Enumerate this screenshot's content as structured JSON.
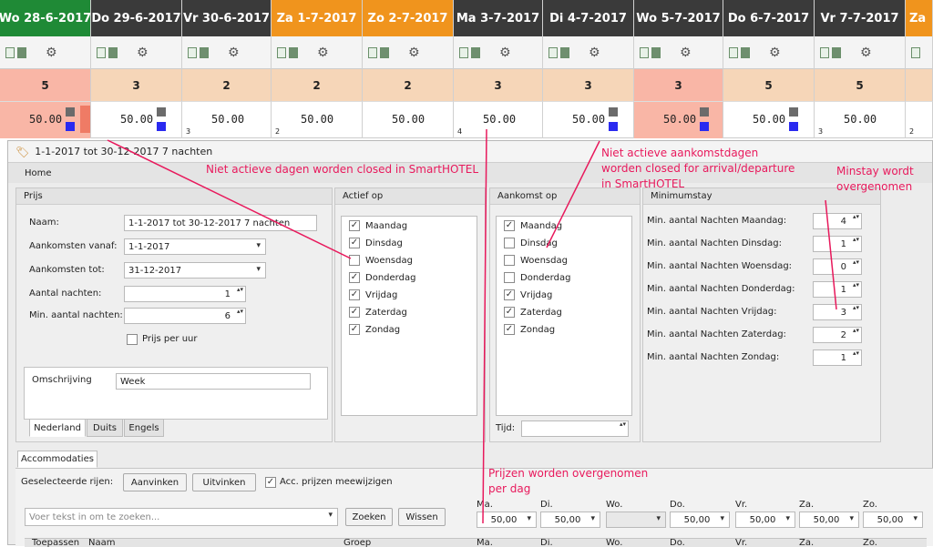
{
  "calendar": {
    "days": [
      {
        "label": "Wo 28-6-2017",
        "color": "#1f8a36",
        "count": "5",
        "price": "50.00",
        "num": ""
      },
      {
        "label": "Do 29-6-2017",
        "color": "#3a3a3a",
        "count": "3",
        "price": "50.00",
        "num": ""
      },
      {
        "label": "Vr 30-6-2017",
        "color": "#3a3a3a",
        "count": "2",
        "price": "50.00",
        "num": "3"
      },
      {
        "label": "Za 1-7-2017",
        "color": "#f0941d",
        "count": "2",
        "price": "50.00",
        "num": "2"
      },
      {
        "label": "Zo 2-7-2017",
        "color": "#f0941d",
        "count": "2",
        "price": "50.00",
        "num": ""
      },
      {
        "label": "Ma 3-7-2017",
        "color": "#3a3a3a",
        "count": "3",
        "price": "50.00",
        "num": "4"
      },
      {
        "label": "Di 4-7-2017",
        "color": "#3a3a3a",
        "count": "3",
        "price": "50.00",
        "num": ""
      },
      {
        "label": "Wo 5-7-2017",
        "color": "#3a3a3a",
        "count": "3",
        "price": "50.00",
        "num": ""
      },
      {
        "label": "Do 6-7-2017",
        "color": "#3a3a3a",
        "count": "5",
        "price": "50.00",
        "num": ""
      },
      {
        "label": "Vr 7-7-2017",
        "color": "#3a3a3a",
        "count": "5",
        "price": "50.00",
        "num": "3"
      },
      {
        "label": "Za",
        "color": "#f0941d",
        "count": "",
        "price": "",
        "num": "2"
      }
    ]
  },
  "dialog": {
    "title": "1-1-2017 tot 30-12-2017 7 nachten",
    "home_tab": "Home",
    "prijs": {
      "title": "Prijs",
      "naam_label": "Naam:",
      "naam_value": "1-1-2017 tot 30-12-2017 7 nachten",
      "aankomsten_vanaf_label": "Aankomsten vanaf:",
      "aankomsten_vanaf_value": "1-1-2017",
      "aankomsten_tot_label": "Aankomsten tot:",
      "aankomsten_tot_value": "31-12-2017",
      "aantal_nachten_label": "Aantal nachten:",
      "aantal_nachten_value": "1",
      "min_aantal_nachten_label": "Min. aantal nachten:",
      "min_aantal_nachten_value": "6",
      "prijs_per_uur_label": "Prijs per uur",
      "omschrijving_label": "Omschrijving",
      "omschrijving_value": "Week",
      "tabs": [
        "Nederland",
        "Duits",
        "Engels"
      ]
    },
    "actief_op": {
      "title": "Actief op",
      "days": [
        {
          "label": "Maandag",
          "checked": true
        },
        {
          "label": "Dinsdag",
          "checked": true
        },
        {
          "label": "Woensdag",
          "checked": false
        },
        {
          "label": "Donderdag",
          "checked": true
        },
        {
          "label": "Vrijdag",
          "checked": true
        },
        {
          "label": "Zaterdag",
          "checked": true
        },
        {
          "label": "Zondag",
          "checked": true
        }
      ]
    },
    "aankomst_op": {
      "title": "Aankomst op",
      "days": [
        {
          "label": "Maandag",
          "checked": true
        },
        {
          "label": "Dinsdag",
          "checked": false
        },
        {
          "label": "Woensdag",
          "checked": false
        },
        {
          "label": "Donderdag",
          "checked": false
        },
        {
          "label": "Vrijdag",
          "checked": true
        },
        {
          "label": "Zaterdag",
          "checked": true
        },
        {
          "label": "Zondag",
          "checked": true
        }
      ],
      "tijd_label": "Tijd:"
    },
    "minimumstay": {
      "title": "Minimumstay",
      "rows": [
        {
          "label": "Min. aantal Nachten Maandag:",
          "value": "4"
        },
        {
          "label": "Min. aantal Nachten Dinsdag:",
          "value": "1"
        },
        {
          "label": "Min. aantal Nachten Woensdag:",
          "value": "0"
        },
        {
          "label": "Min. aantal Nachten Donderdag:",
          "value": "1"
        },
        {
          "label": "Min. aantal Nachten Vrijdag:",
          "value": "3"
        },
        {
          "label": "Min. aantal Nachten Zaterdag:",
          "value": "2"
        },
        {
          "label": "Min. aantal Nachten Zondag:",
          "value": "1"
        }
      ]
    },
    "accommodaties": {
      "tab": "Accommodaties",
      "geselecteerde_label": "Geselecteerde rijen:",
      "aanvinken": "Aanvinken",
      "uitvinken": "Uitvinken",
      "acc_prijzen_label": "Acc. prijzen meewijzigen",
      "search_placeholder": "Voer tekst in om te zoeken...",
      "zoeken": "Zoeken",
      "wissen": "Wissen",
      "day_prices": [
        {
          "day": "Ma.",
          "value": "50,00"
        },
        {
          "day": "Di.",
          "value": "50,00"
        },
        {
          "day": "Wo.",
          "value": ""
        },
        {
          "day": "Do.",
          "value": "50,00"
        },
        {
          "day": "Vr.",
          "value": "50,00"
        },
        {
          "day": "Za.",
          "value": "50,00"
        },
        {
          "day": "Zo.",
          "value": "50,00"
        }
      ],
      "columns": [
        "Toepassen",
        "Naam",
        "Groep",
        "Ma.",
        "Di.",
        "Wo.",
        "Do.",
        "Vr.",
        "Za.",
        "Zo."
      ]
    }
  },
  "annotations": {
    "niet_actieve_dagen": "Niet actieve dagen worden closed in SmartHOTEL",
    "niet_actieve_aankomst": [
      "Niet actieve aankomstdagen",
      "worden closed for arrival/departure",
      "in SmartHOTEL"
    ],
    "minstay": [
      "Minstay wordt",
      "overgenomen"
    ],
    "prijzen": [
      "Prijzen worden overgenomen",
      "per dag"
    ],
    "color": "#e8195c"
  }
}
